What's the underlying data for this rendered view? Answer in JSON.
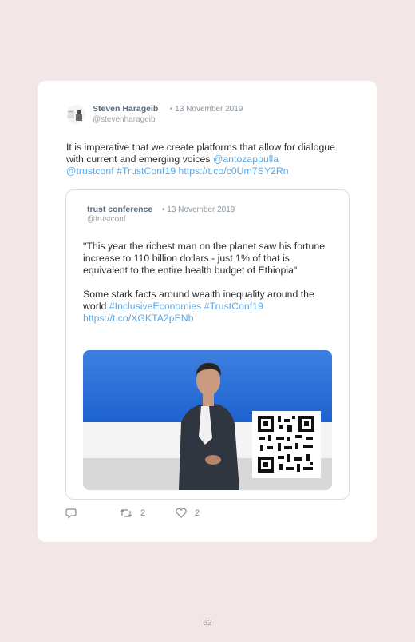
{
  "tweet": {
    "author_name": "Steven Harageib",
    "date": "• 13 November 2019",
    "handle": "@stevenharageib",
    "text_plain": "It is imperative that we create platforms that allow for dialogue with current and emerging voices ",
    "mention_1": "@antozappulla",
    "mention_2": "@trustconf",
    "hashtag": "#TrustConf19",
    "link": "https://t.co/c0Um7SY2Rn"
  },
  "quoted": {
    "author_name": "trust conference",
    "date": "• 13 November 2019",
    "handle": "@trustconf",
    "paragraph_1": "\"This year the richest man on the planet saw his fortune increase to 110 billion dollars - just 1% of that is equivalent to the entire health budget of Ethiopia\"",
    "paragraph_2_plain": "Some stark facts around wealth inequality around the world ",
    "hashtag_1": "#InclusiveEconomies",
    "hashtag_2": "#TrustConf19",
    "link": "https://t.co/XGKTA2pENb"
  },
  "actions": {
    "reply_count": "",
    "retweet_count": "2",
    "like_count": "2"
  },
  "colors": {
    "background": "#f2e6e6",
    "link": "#5aa8e8",
    "muted": "#8c96a0"
  },
  "icons": [
    "reply-icon",
    "retweet-icon",
    "like-icon",
    "qr-code-icon"
  ],
  "page_number": "62"
}
